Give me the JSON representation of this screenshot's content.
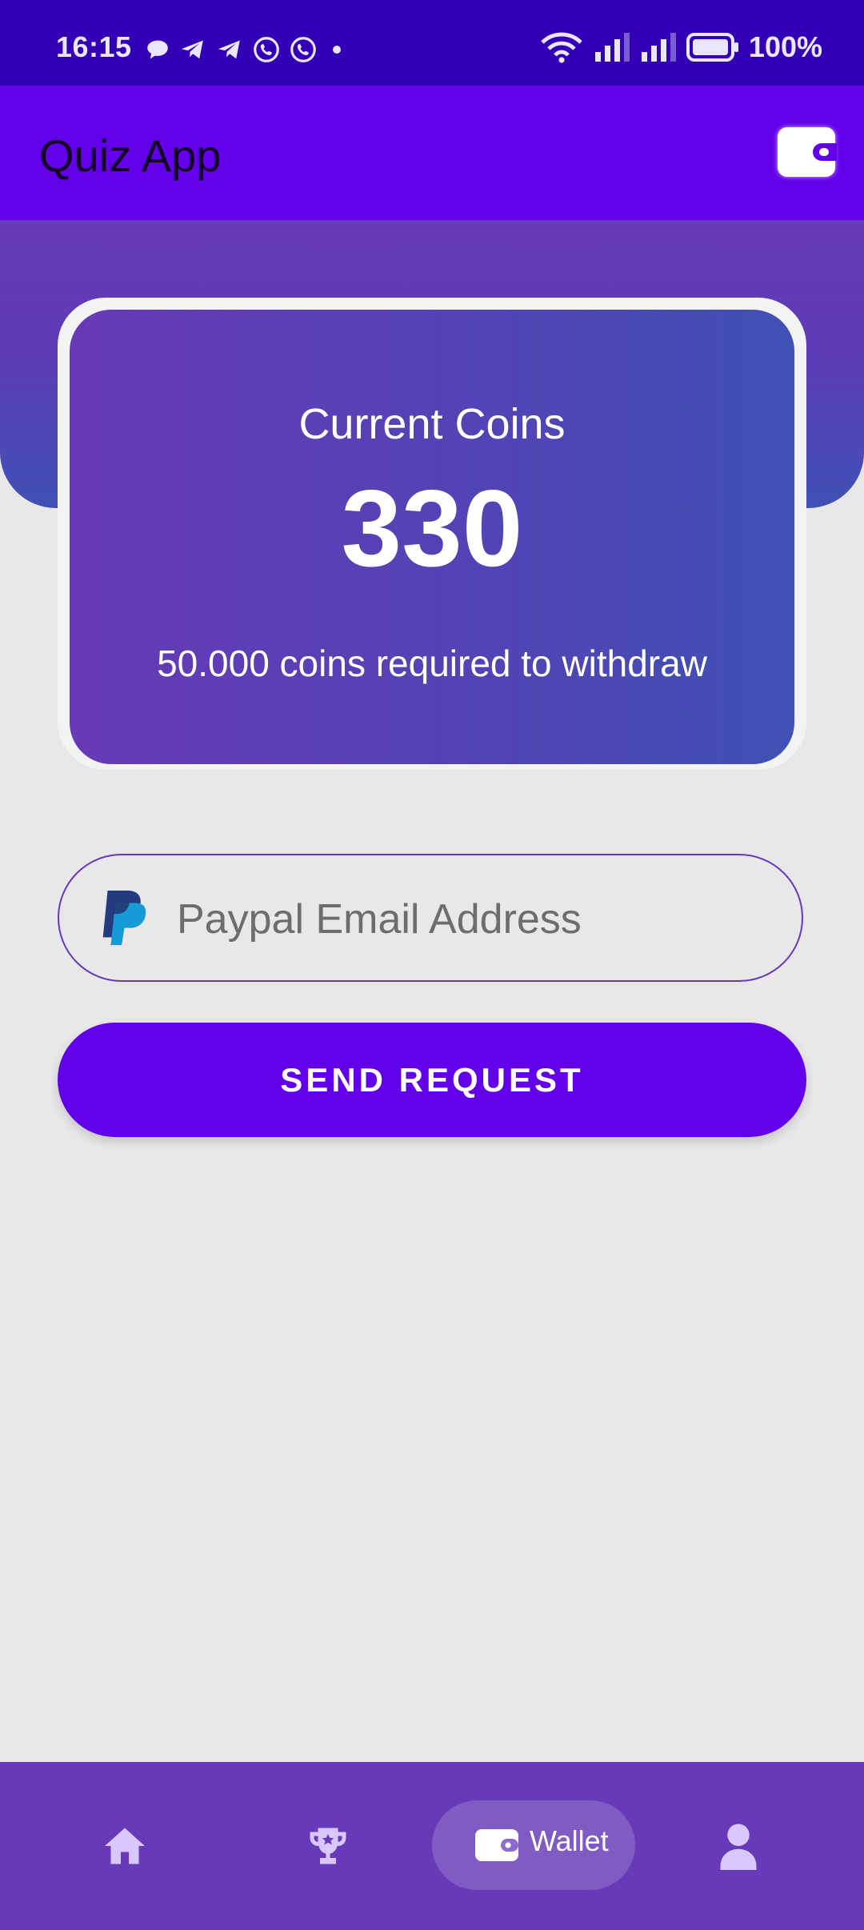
{
  "status_bar": {
    "time": "16:15",
    "battery": "100%",
    "icons": [
      "chat-bubble-icon",
      "telegram-icon",
      "telegram-icon",
      "whatsapp-icon",
      "whatsapp-icon",
      "dot-icon",
      "wifi-icon",
      "signal-icon",
      "signal-icon",
      "battery-icon"
    ]
  },
  "app_bar": {
    "title": "Quiz App",
    "action_icon": "wallet-icon"
  },
  "coins_card": {
    "label": "Current Coins",
    "value": "330",
    "requirement": "50.000 coins required to withdraw"
  },
  "email_field": {
    "placeholder": "Paypal Email Address",
    "value": "",
    "icon": "paypal-icon"
  },
  "send_button": {
    "label": "SEND REQUEST"
  },
  "bottom_nav": {
    "items": [
      {
        "icon": "home-icon",
        "label": ""
      },
      {
        "icon": "trophy-icon",
        "label": ""
      },
      {
        "icon": "wallet-icon",
        "label": "Wallet",
        "active": true
      },
      {
        "icon": "profile-icon",
        "label": ""
      }
    ]
  },
  "colors": {
    "status_bar": "#3300b6",
    "app_bar": "#6200ea",
    "card_start": "#673ab7",
    "card_end": "#3f51b5",
    "button": "#6200ea",
    "nav": "#673ab7",
    "background": "#e8e7e9"
  }
}
